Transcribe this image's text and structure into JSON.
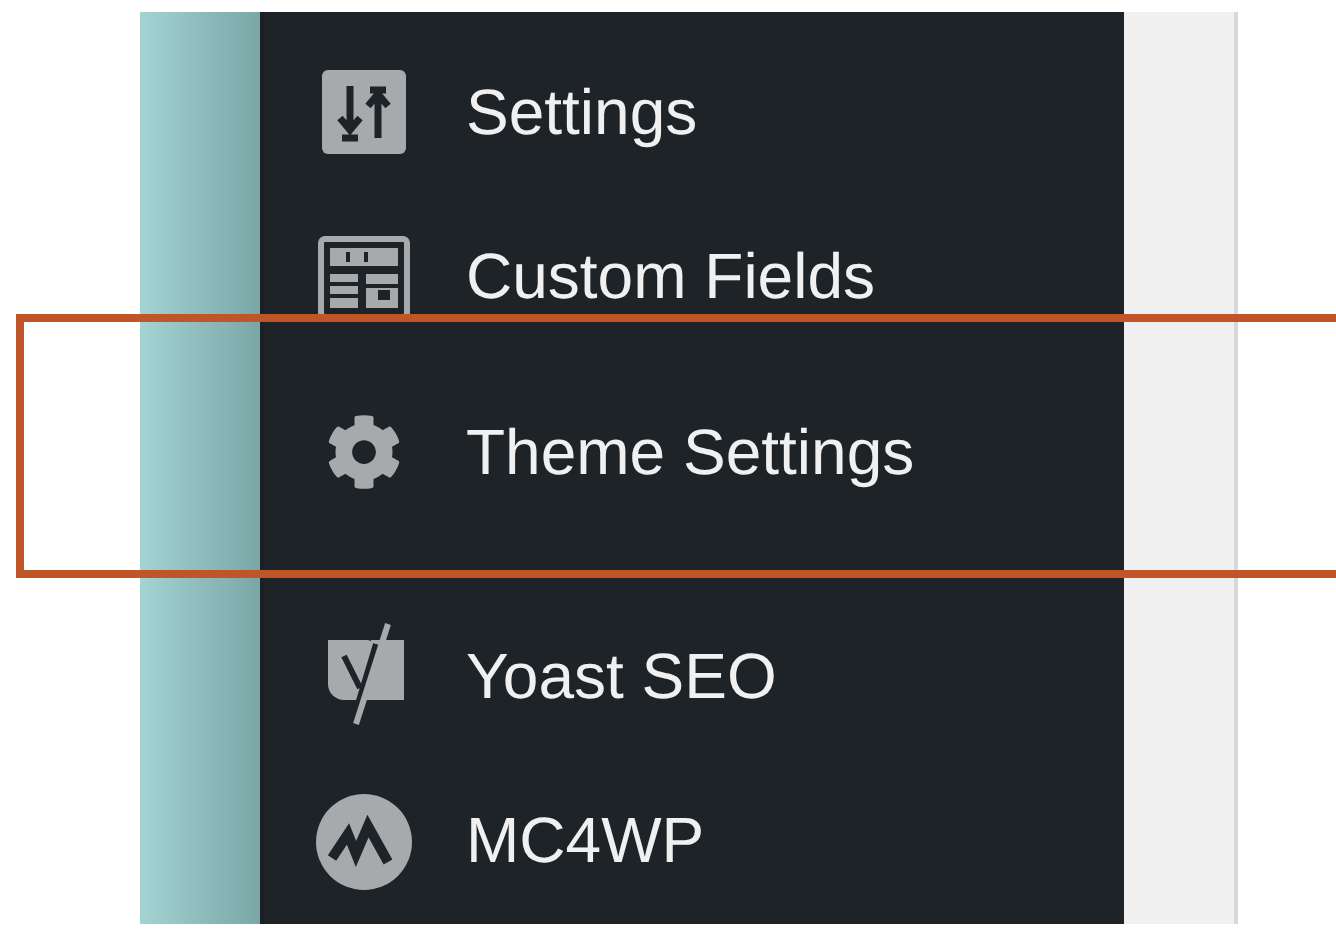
{
  "menu": {
    "items": [
      {
        "label": "Settings",
        "kind": "sliders",
        "highlighted": false
      },
      {
        "label": "Custom Fields",
        "kind": "fields",
        "highlighted": false
      },
      {
        "label": "Theme Settings",
        "kind": "gear",
        "highlighted": true
      },
      {
        "label": "Yoast SEO",
        "kind": "yoast",
        "highlighted": false
      },
      {
        "label": "MC4WP",
        "kind": "mc4wp",
        "highlighted": false
      }
    ]
  }
}
